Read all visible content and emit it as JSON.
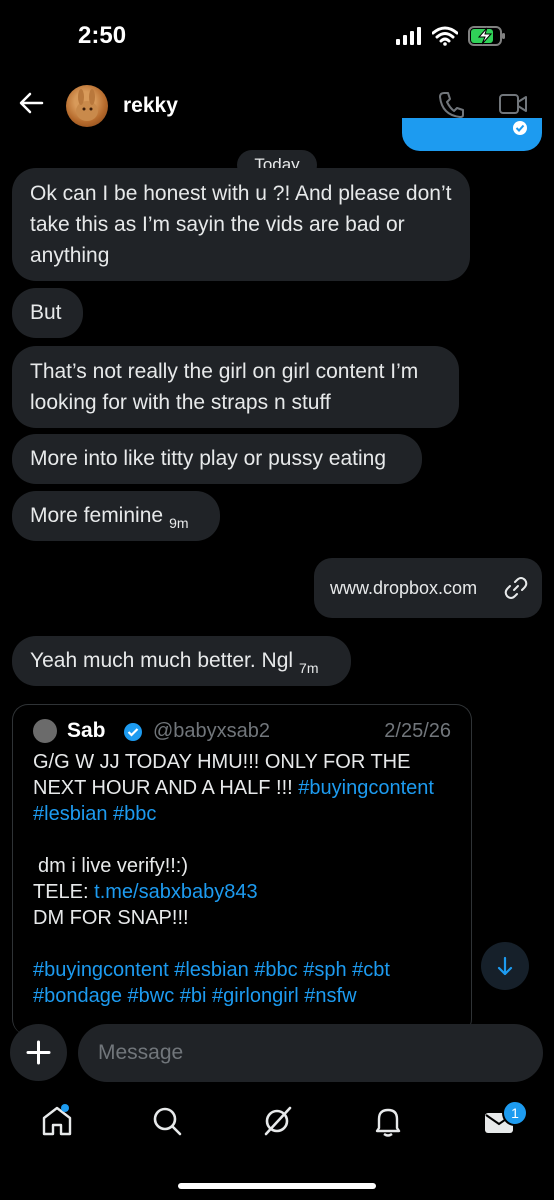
{
  "status": {
    "time": "2:50"
  },
  "header": {
    "name": "rekky"
  },
  "divider": {
    "today": "Today"
  },
  "messages": [
    {
      "text": "Ok can I be honest with u ?! And please don’t take this as I’m sayin the vids are bad or anything"
    },
    {
      "text": "But"
    },
    {
      "text": "That’s not really the girl on girl content I’m looking for with the straps n stuff"
    },
    {
      "text": "More into like titty play or pussy eating"
    },
    {
      "text": "More feminine",
      "time": "9m"
    },
    {
      "text": "Yeah much much better. Ngl",
      "time": "7m"
    }
  ],
  "outgoing": {
    "link_text": "www.dropbox.com"
  },
  "tweet": {
    "name": "Sab",
    "handle": "@babyxsab2",
    "date": "2/25/26",
    "line1": "G/G W JJ TODAY HMU!!! ONLY FOR THE NEXT HOUR AND A HALF !!! ",
    "tags1": "#buyingcontent",
    "tags2": "#lesbian #bbc",
    "line2": "dm i live verify!!:)",
    "tele_label": "TELE: ",
    "tele_link": "t.me/sabxbaby843",
    "line3": "DM FOR SNAP!!!",
    "tags3": "#buyingcontent #lesbian #bbc  #sph #cbt",
    "tags4": "#bondage #bwc #bi #girlongirl #nsfw"
  },
  "composer": {
    "placeholder": "Message"
  },
  "tabbar": {
    "messages_badge": "1"
  },
  "colors": {
    "accent": "#1d9bf0",
    "bubble": "#202327",
    "bg": "#000000"
  }
}
